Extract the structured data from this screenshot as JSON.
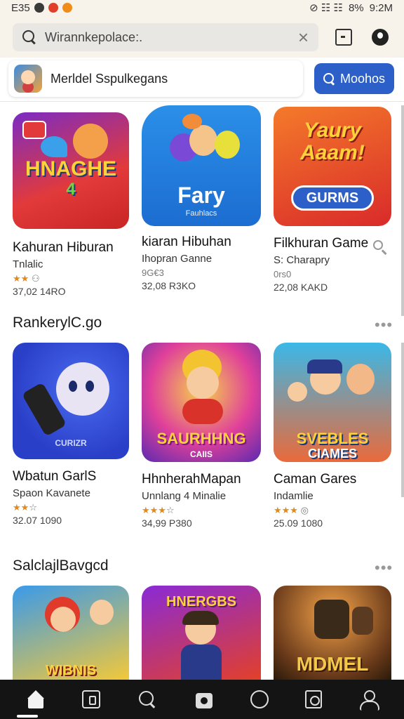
{
  "status_bar": {
    "time_left": "E35",
    "indicators": "◎ ◉ ◉",
    "right_icons": "⊘ ☷ ☷",
    "battery": "8%",
    "time_right": "9:2M"
  },
  "search": {
    "placeholder": "Wirannkepolace:.",
    "clear_icon": "close-icon"
  },
  "banner": {
    "text": "Merldel Sspulkegans",
    "button_label": "Moohos"
  },
  "sections": [
    {
      "title": "",
      "cards": [
        {
          "name": "Kahuran Hiburan",
          "sub": "Tnlalic",
          "rating": "★★",
          "rating_icon": "⚇",
          "count": "37,02 14RO",
          "art_text": "HNAGHE",
          "art_sub": "4"
        },
        {
          "name": "kiaran Hibuhan",
          "sub": "Ihopran Ganne",
          "rating": "",
          "rating_icon": "9G€3",
          "count": "32,08 R3KO",
          "art_text": "Fary",
          "art_sub": "Fauhlacs"
        },
        {
          "name": "Filkhuran Game",
          "sub": "S: Charapry",
          "rating": "",
          "rating_icon": "0rs0",
          "count": "22,08 KAKD",
          "art_text": "Yaury Aaam!",
          "art_sub": "GURMS"
        }
      ]
    },
    {
      "title": "RankerylC.go",
      "cards": [
        {
          "name": "Wbatun GarlS",
          "sub": "Spaon Kavanete",
          "rating": "★★",
          "rating_icon": "☆",
          "count": "32.07 1090",
          "art_text": "CURIZR",
          "art_sub": ""
        },
        {
          "name": "HhnherahMapan",
          "sub": "Unnlang 4 Minalie",
          "rating": "★★★",
          "rating_icon": "☆",
          "count": "34,99 P380",
          "art_text": "SAURHHNG",
          "art_sub": "CAIIS"
        },
        {
          "name": "Caman Gares",
          "sub": "Indamlie",
          "rating": "★★★",
          "rating_icon": "◎",
          "count": "25.09 1080",
          "art_text": "SVEBLES",
          "art_sub": "CIAMES"
        }
      ]
    },
    {
      "title": "SalclajlBavgcd",
      "cards": [
        {
          "art_text": "WIBNIS",
          "art_sub": ""
        },
        {
          "art_text": "HNERGBS",
          "art_sub": ""
        },
        {
          "art_text": "MDMEL",
          "art_sub": ""
        }
      ]
    }
  ],
  "more_label": "•••",
  "bottom_nav": [
    "home-icon",
    "library-icon",
    "search-icon",
    "store-icon",
    "circle-icon",
    "books-icon",
    "profile-icon"
  ],
  "colors": {
    "accent": "#2c5fc7",
    "background": "#ffffff",
    "nav_bg": "#141414",
    "star": "#e08a1e"
  }
}
